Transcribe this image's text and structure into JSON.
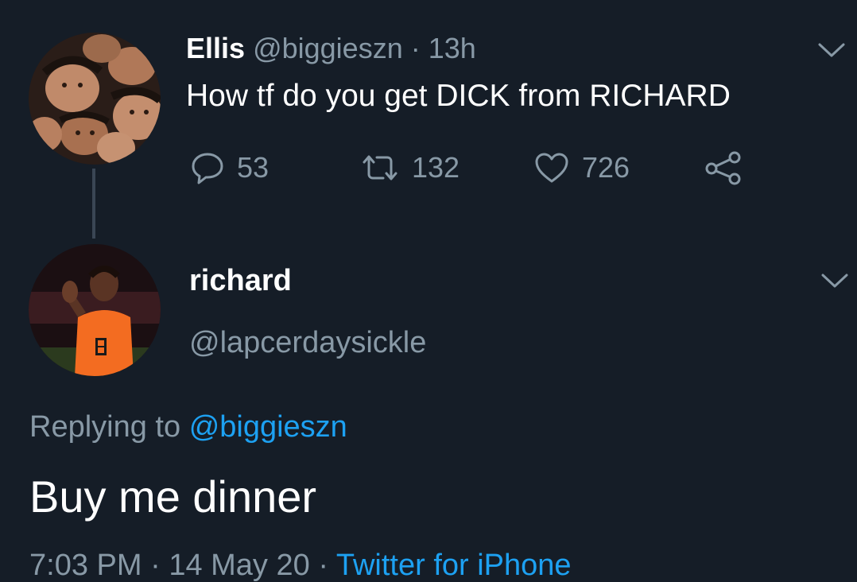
{
  "parent_tweet": {
    "display_name": "Ellis",
    "handle": "@biggieszn",
    "separator": "·",
    "time": "13h",
    "text": "How tf do you get DICK from RICHARD",
    "replies": "53",
    "retweets": "132",
    "likes": "726",
    "icons": [
      "reply-icon",
      "retweet-icon",
      "like-icon",
      "share-icon",
      "chevron-down-icon"
    ]
  },
  "reply_tweet": {
    "display_name": "richard",
    "handle": "@lapcerdaysickle",
    "replying_prefix": "Replying to",
    "replying_to": "@biggieszn",
    "text": "Buy me dinner",
    "time": "7:03 PM",
    "separator": "·",
    "date": "14 May 20",
    "source": "Twitter for iPhone"
  },
  "colors": {
    "background": "#151d27",
    "text": "#ffffff",
    "muted": "#8899a6",
    "link": "#1da1f2",
    "jersey": "#f36c21"
  }
}
